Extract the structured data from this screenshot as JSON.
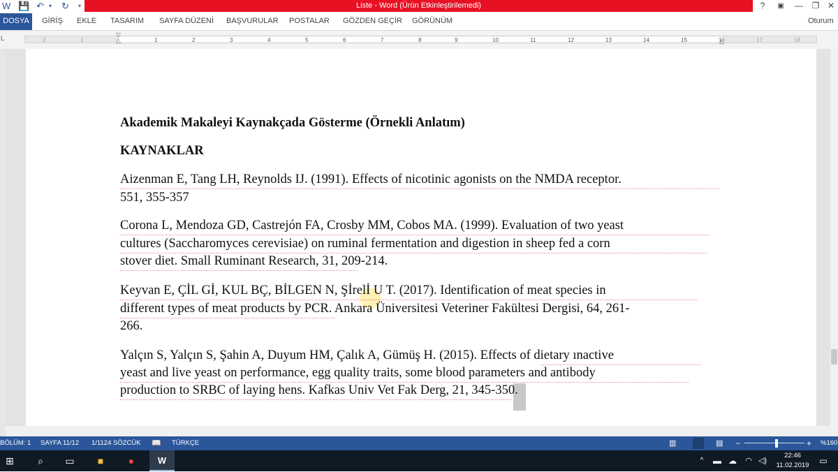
{
  "window": {
    "title": "Liste - Word (Ürün Etkinleştirilemedi)",
    "signin": "Oturum a",
    "help": "?",
    "min": "—",
    "restore": "❐",
    "close": "✕"
  },
  "ribbon": {
    "tabs": [
      "DOSYA",
      "GİRİŞ",
      "EKLE",
      "TASARIM",
      "SAYFA DÜZENİ",
      "BAŞVURULAR",
      "POSTALAR",
      "GÖZDEN GEÇİR",
      "GÖRÜNÜM"
    ]
  },
  "ruler": {
    "labels": [
      "2",
      "1",
      "1",
      "2",
      "3",
      "4",
      "5",
      "6",
      "7",
      "8",
      "9",
      "10",
      "11",
      "12",
      "13",
      "14",
      "15",
      "16",
      "17",
      "18"
    ]
  },
  "document": {
    "heading": "Akademik Makaleyi Kaynakçada Gösterme (Örnekli Anlatım)",
    "section": "KAYNAKLAR",
    "refs": [
      [
        "Aizenman E, Tang LH, Reynolds IJ. (1991). Effects of nicotinic agonists on the NMDA receptor.",
        "551, 355-357"
      ],
      [
        "Corona L, Mendoza GD, Castrejón FA, Crosby MM, Cobos MA. (1999). Evaluation of two yeast",
        "cultures (Saccharomyces cerevisiae) on ruminal fermentation and digestion in sheep fed a corn",
        "stover diet. Small Ruminant Research, 31, 209-214."
      ],
      [
        "Keyvan E, ÇİL Gİ, KUL BÇ, BİLGEN N, Şİrelİ U T. (2017). Identification of meat species in",
        "different types of meat products by PCR. Ankara Üniversitesi Veteriner Fakültesi Dergisi, 64, 261-",
        "266."
      ],
      [
        "Yalçın S, Yalçın S, Şahin A, Duyum HM, Çalık A, Gümüş H. (2015). Effects of dietary ınactive",
        "yeast and live yeast on performance, egg quality traits, some blood parameters and antibody",
        "production to SRBC of laying hens. Kafkas Univ Vet Fak Derg, 21, 345-350."
      ]
    ]
  },
  "status": {
    "section": "BÖLÜM: 1",
    "page": "SAYFA 11/12",
    "words": "1/1124 SÖZCÜK",
    "language": "TÜRKÇE",
    "zoom": "%160"
  },
  "taskbar": {
    "time": "22:46",
    "date": "11.02.2019"
  },
  "colors": {
    "word_blue": "#2b579a",
    "title_red": "#e81123",
    "squiggle": "#e0312b"
  }
}
